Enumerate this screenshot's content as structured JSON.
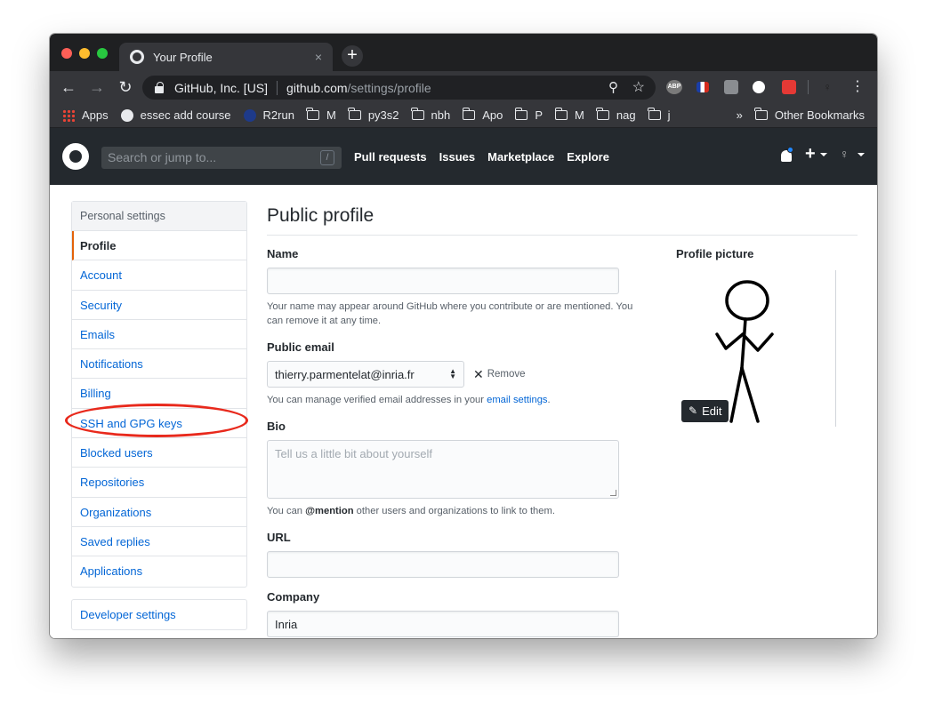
{
  "browser": {
    "tab_title": "Your Profile",
    "tab_close": "×",
    "new_tab": "+",
    "omnibox_org": "GitHub, Inc. [US]",
    "omnibox_host": "github.com",
    "omnibox_path": "/settings/profile",
    "bookmarks": [
      "Apps",
      "essec add course",
      "R2run",
      "M",
      "py3s2",
      "nbh",
      "Apo",
      "P",
      "M",
      "nag",
      "j"
    ],
    "bookmarks_more": "»",
    "other_bookmarks": "Other Bookmarks",
    "extensions": {
      "abp": "ABP"
    }
  },
  "github_header": {
    "search_placeholder": "Search or jump to...",
    "search_shortcut": "/",
    "nav": [
      "Pull requests",
      "Issues",
      "Marketplace",
      "Explore"
    ],
    "new_label": "+"
  },
  "sidebar": {
    "heading": "Personal settings",
    "items": [
      "Profile",
      "Account",
      "Security",
      "Emails",
      "Notifications",
      "Billing",
      "SSH and GPG keys",
      "Blocked users",
      "Repositories",
      "Organizations",
      "Saved replies",
      "Applications"
    ],
    "selected_index": 0,
    "developer_settings": "Developer settings"
  },
  "main": {
    "title": "Public profile",
    "name_label": "Name",
    "name_value": "",
    "name_note": "Your name may appear around GitHub where you contribute or are mentioned. You can remove it at any time.",
    "email_label": "Public email",
    "email_value": "thierry.parmentelat@inria.fr",
    "remove_label": "Remove",
    "email_note_prefix": "You can manage verified email addresses in your ",
    "email_note_link": "email settings",
    "email_note_suffix": ".",
    "bio_label": "Bio",
    "bio_placeholder": "Tell us a little bit about yourself",
    "bio_note_prefix": "You can ",
    "bio_note_bold": "@mention",
    "bio_note_suffix": " other users and organizations to link to them.",
    "url_label": "URL",
    "url_value": "",
    "company_label": "Company",
    "company_value": "Inria"
  },
  "profile_picture": {
    "label": "Profile picture",
    "edit_label": "Edit"
  },
  "colors": {
    "link": "#0366d6",
    "header_bg": "#24292e",
    "selected_border": "#e36209",
    "annotation": "#e8291c"
  }
}
